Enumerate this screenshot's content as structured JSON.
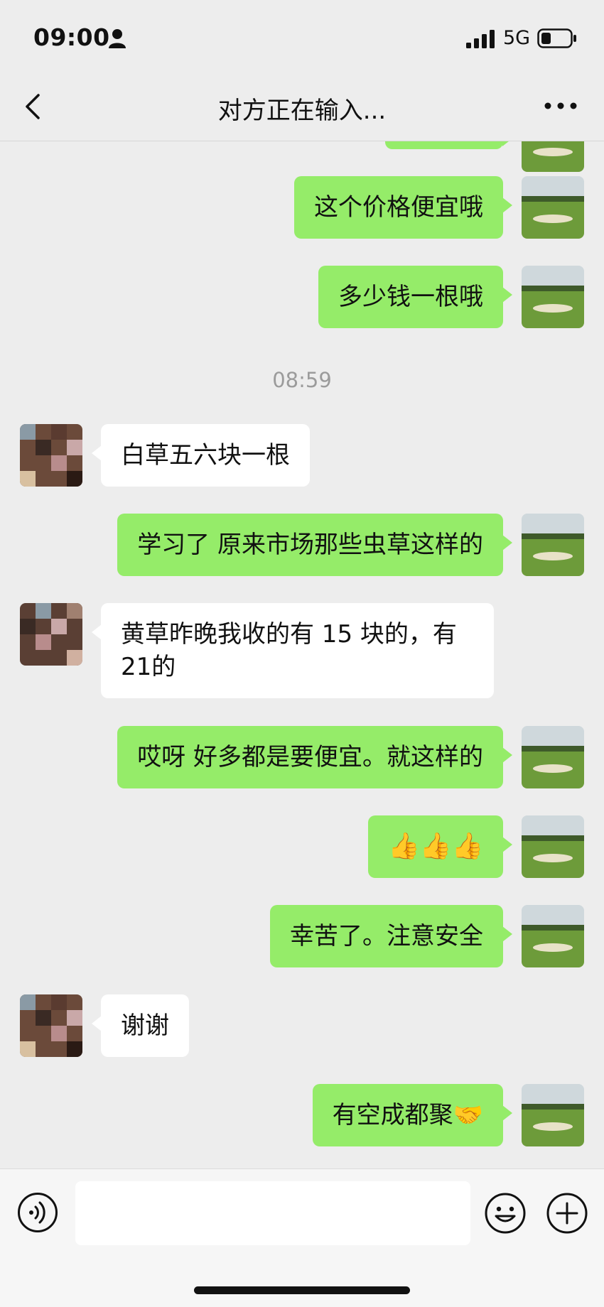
{
  "status_bar": {
    "time": "09:00",
    "network": "5G"
  },
  "header": {
    "title": "对方正在输入..."
  },
  "timestamp": "08:59",
  "messages": [
    {
      "from": "me",
      "text": "这个价格便宜哦"
    },
    {
      "from": "me",
      "text": "多少钱一根哦"
    },
    {
      "from": "other",
      "text": "白草五六块一根"
    },
    {
      "from": "me",
      "text": "学习了 原来市场那些虫草这样的"
    },
    {
      "from": "other",
      "text": "黄草昨晚我收的有 15 块的，有 21的"
    },
    {
      "from": "me",
      "text": "哎呀 好多都是要便宜。就这样的"
    },
    {
      "from": "me",
      "text": "👍👍👍"
    },
    {
      "from": "me",
      "text": "幸苦了。注意安全"
    },
    {
      "from": "other",
      "text": "谢谢"
    },
    {
      "from": "me",
      "text": "有空成都聚🤝"
    }
  ],
  "colors": {
    "my_bubble": "#95ec69",
    "their_bubble": "#ffffff",
    "background": "#ededed"
  },
  "icons": {
    "back": "chevron-left-icon",
    "more": "more-dots-icon",
    "voice": "voice-icon",
    "emoji": "emoji-icon",
    "add": "plus-icon"
  }
}
